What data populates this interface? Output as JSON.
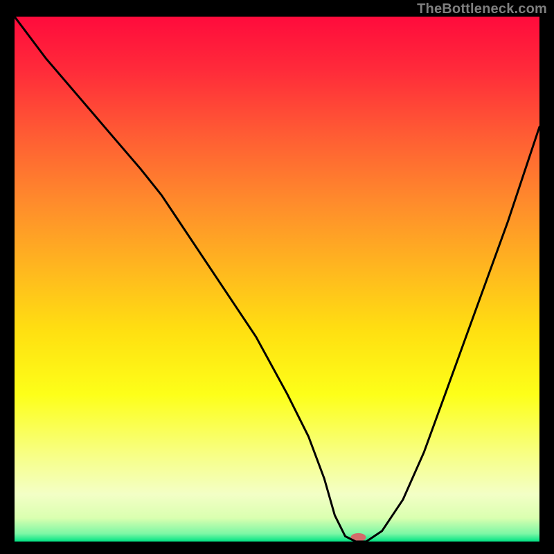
{
  "attribution": "TheBottleneck.com",
  "chart_data": {
    "type": "line",
    "title": "",
    "xlabel": "",
    "ylabel": "",
    "xlim": [
      0,
      100
    ],
    "ylim": [
      0,
      100
    ],
    "gradient_stops": [
      {
        "offset": 0.0,
        "color": "#ff0b3c"
      },
      {
        "offset": 0.1,
        "color": "#ff2a3a"
      },
      {
        "offset": 0.22,
        "color": "#ff5a34"
      },
      {
        "offset": 0.35,
        "color": "#ff8a2c"
      },
      {
        "offset": 0.48,
        "color": "#ffb71f"
      },
      {
        "offset": 0.6,
        "color": "#ffe011"
      },
      {
        "offset": 0.72,
        "color": "#fdff19"
      },
      {
        "offset": 0.84,
        "color": "#f7ff8a"
      },
      {
        "offset": 0.91,
        "color": "#f3ffc6"
      },
      {
        "offset": 0.955,
        "color": "#daffb0"
      },
      {
        "offset": 0.985,
        "color": "#7cf7a5"
      },
      {
        "offset": 1.0,
        "color": "#00e384"
      }
    ],
    "series": [
      {
        "name": "bottleneck-curve",
        "x": [
          0,
          6,
          12,
          18,
          24,
          28,
          34,
          40,
          46,
          52,
          56,
          59,
          61,
          63,
          65,
          67,
          70,
          74,
          78,
          82,
          86,
          90,
          94,
          98,
          100
        ],
        "y": [
          100,
          92,
          85,
          78,
          71,
          66,
          57,
          48,
          39,
          28,
          20,
          12,
          5,
          1,
          0,
          0,
          2,
          8,
          17,
          28,
          39,
          50,
          61,
          73,
          79
        ]
      }
    ],
    "marker": {
      "x": 65.5,
      "y": 0.8,
      "color": "#d46a6a",
      "rx": 11,
      "ry": 6
    }
  }
}
